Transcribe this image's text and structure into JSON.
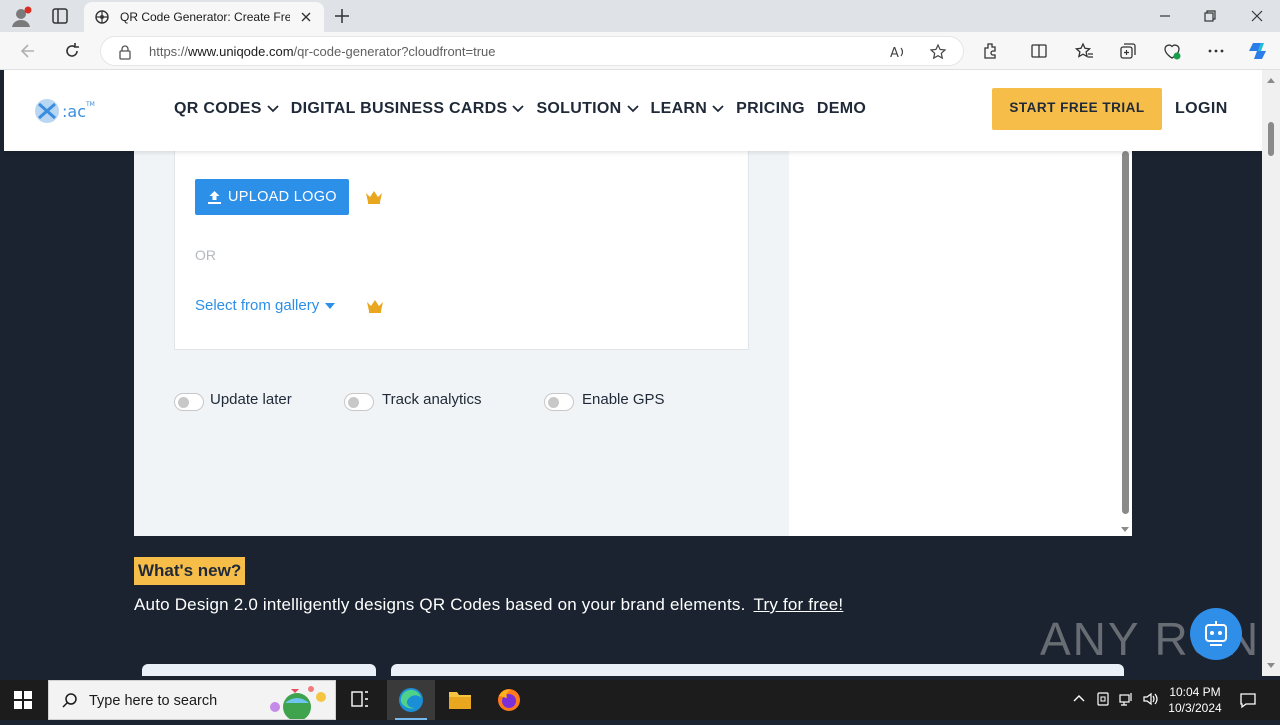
{
  "browser": {
    "tab_title": "QR Code Generator: Create Free QR Codes",
    "url_prefix": "https://",
    "url_domain": "www.uniqode.com",
    "url_path": "/qr-code-generator?cloudfront=true"
  },
  "site": {
    "nav": [
      {
        "label": "QR CODES",
        "has_dropdown": true
      },
      {
        "label": "DIGITAL BUSINESS CARDS",
        "has_dropdown": true
      },
      {
        "label": "SOLUTION",
        "has_dropdown": true
      },
      {
        "label": "LEARN",
        "has_dropdown": true
      },
      {
        "label": "PRICING",
        "has_dropdown": false
      },
      {
        "label": "DEMO",
        "has_dropdown": false
      }
    ],
    "trial_button": "START FREE TRIAL",
    "login": "LOGIN",
    "accent_color": "#f7bd49",
    "primary_color": "#2c8fe8"
  },
  "logo_section": {
    "upload_button": "UPLOAD LOGO",
    "or_text": "OR",
    "gallery_link": "Select from gallery"
  },
  "toggles": [
    {
      "label": "Update later",
      "on": false
    },
    {
      "label": "Track analytics",
      "on": false
    },
    {
      "label": "Enable GPS",
      "on": false
    }
  ],
  "whats_new": {
    "badge": "What's new?",
    "text": "Auto Design 2.0 intelligently designs QR Codes based on your brand elements.",
    "link": "Try for free!"
  },
  "watermark": "ANY RUN",
  "taskbar": {
    "search_placeholder": "Type here to search",
    "time": "10:04 PM",
    "date": "10/3/2024"
  }
}
